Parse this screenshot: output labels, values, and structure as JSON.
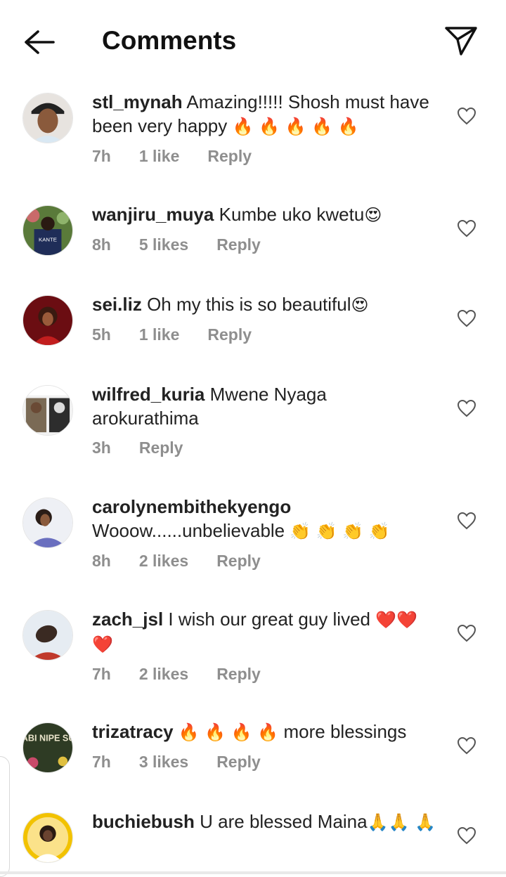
{
  "header": {
    "title": "Comments"
  },
  "comments": [
    {
      "username": "stl_mynah",
      "text": "Amazing!!!!! Shosh must have been very happy",
      "emoji": "🔥 🔥 🔥 🔥 🔥",
      "time": "7h",
      "likes": "1 like",
      "reply": "Reply"
    },
    {
      "username": "wanjiru_muya",
      "text": "Kumbe uko kwetu",
      "emoji": "😍",
      "time": "8h",
      "likes": "5 likes",
      "reply": "Reply",
      "avatar_text": "KANTE"
    },
    {
      "username": "sei.liz",
      "text": "Oh my this is so beautiful",
      "emoji": "😍",
      "time": "5h",
      "likes": "1 like",
      "reply": "Reply"
    },
    {
      "username": "wilfred_kuria",
      "text": "Mwene Nyaga arokurathima",
      "emoji": "",
      "time": "3h",
      "likes": "",
      "reply": "Reply"
    },
    {
      "username": "carolynembithekyengo",
      "text": "Wooow......unbelievable",
      "emoji": "👏 👏 👏 👏",
      "time": "8h",
      "likes": "2 likes",
      "reply": "Reply"
    },
    {
      "username": "zach_jsl",
      "text": "I wish our great guy lived",
      "emoji": "❤️❤️ ❤️",
      "time": "7h",
      "likes": "2 likes",
      "reply": "Reply"
    },
    {
      "username": "trizatracy",
      "text": "more blessings",
      "emoji": "🔥 🔥 🔥 🔥",
      "time": "7h",
      "likes": "3 likes",
      "reply": "Reply",
      "avatar_text": "YA RABI NIPE SUBRA"
    },
    {
      "username": "buchiebush",
      "text": "U are blessed Maina",
      "emoji": "🙏🙏 🙏",
      "time": "",
      "likes": "",
      "reply": ""
    }
  ],
  "icons": {
    "back": "arrow-left-icon",
    "send": "paper-plane-icon",
    "like": "heart-outline-icon"
  },
  "colors": {
    "text": "#262626",
    "meta": "#8e8e8e",
    "background": "#ffffff"
  }
}
